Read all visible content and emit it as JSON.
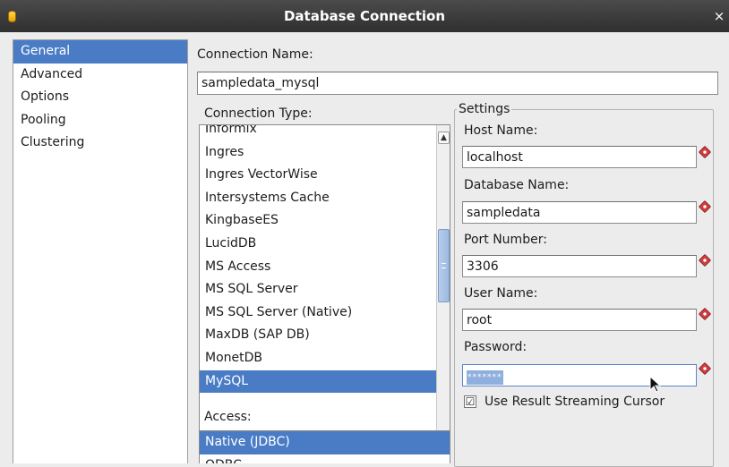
{
  "window": {
    "title": "Database Connection",
    "close_glyph": "×"
  },
  "sidebar": {
    "items": [
      {
        "label": "General",
        "active": true
      },
      {
        "label": "Advanced",
        "active": false
      },
      {
        "label": "Options",
        "active": false
      },
      {
        "label": "Pooling",
        "active": false
      },
      {
        "label": "Clustering",
        "active": false
      }
    ]
  },
  "general": {
    "connection_name_label": "Connection Name:",
    "connection_name_value": "sampledata_mysql",
    "connection_type_label": "Connection Type:",
    "connection_types": [
      {
        "label": "Informix",
        "selected": false
      },
      {
        "label": "Ingres",
        "selected": false
      },
      {
        "label": "Ingres VectorWise",
        "selected": false
      },
      {
        "label": "Intersystems Cache",
        "selected": false
      },
      {
        "label": "KingbaseES",
        "selected": false
      },
      {
        "label": "LucidDB",
        "selected": false
      },
      {
        "label": "MS Access",
        "selected": false
      },
      {
        "label": "MS SQL Server",
        "selected": false
      },
      {
        "label": "MS SQL Server (Native)",
        "selected": false
      },
      {
        "label": "MaxDB (SAP DB)",
        "selected": false
      },
      {
        "label": "MonetDB",
        "selected": false
      },
      {
        "label": "MySQL",
        "selected": true
      }
    ],
    "access_label": "Access:",
    "access_types": [
      {
        "label": "Native (JDBC)",
        "selected": true
      },
      {
        "label": "ODBC",
        "selected": false
      }
    ]
  },
  "settings": {
    "legend": "Settings",
    "host_name_label": "Host Name:",
    "host_name_value": "localhost",
    "database_name_label": "Database Name:",
    "database_name_value": "sampledata",
    "port_number_label": "Port Number:",
    "port_number_value": "3306",
    "user_name_label": "User Name:",
    "user_name_value": "root",
    "password_label": "Password:",
    "password_value": "*******",
    "streaming_cursor_label": "Use Result Streaming Cursor",
    "streaming_cursor_checked": true,
    "checkbox_glyph": "☑"
  },
  "colors": {
    "selection": "#4a7cc6",
    "titlebar": "#3a3a3a",
    "required_marker": "#d63a3a"
  },
  "icons": {
    "app": "database-icon",
    "close": "close-icon",
    "required": "required-field-icon",
    "scroll_up": "chevron-up-icon",
    "scroll_down": "chevron-down-icon"
  }
}
